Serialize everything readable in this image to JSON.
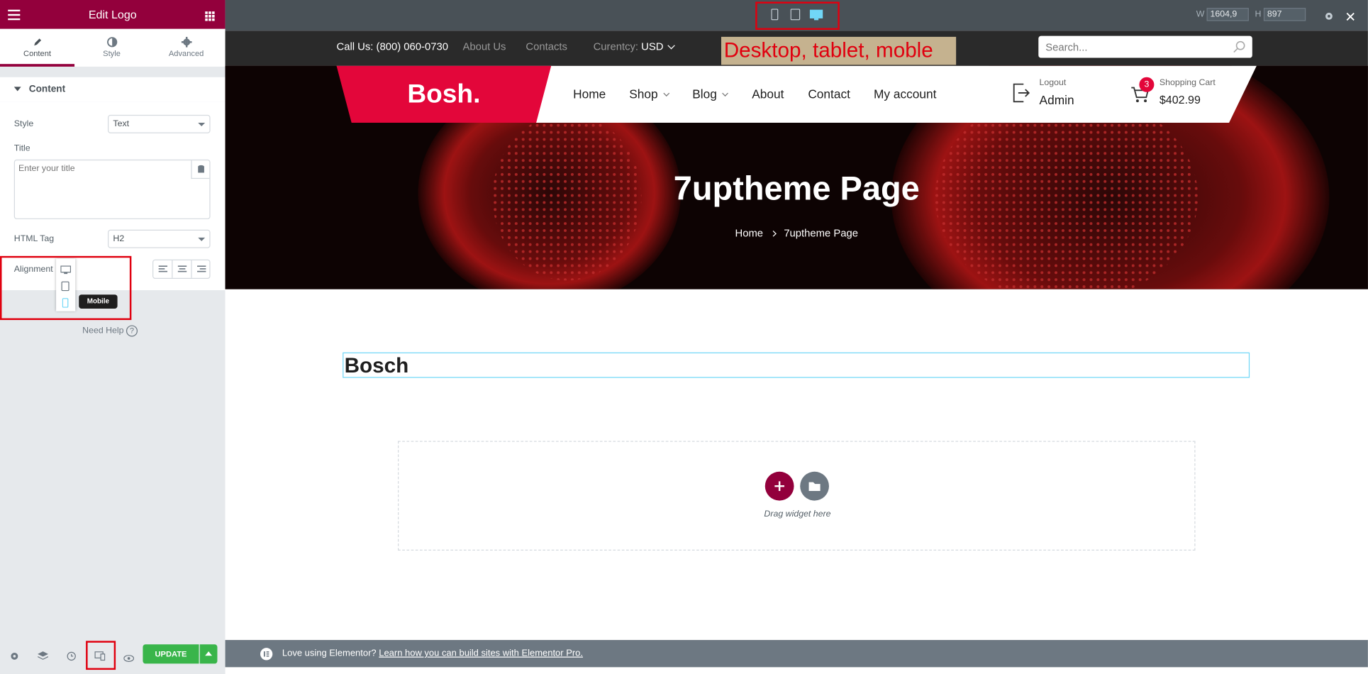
{
  "panel": {
    "title": "Edit Logo",
    "tabs": [
      {
        "label": "Content",
        "icon": "pencil-icon",
        "active": true
      },
      {
        "label": "Style",
        "icon": "contrast-icon"
      },
      {
        "label": "Advanced",
        "icon": "gear-icon"
      }
    ],
    "section_title": "Content",
    "style_label": "Style",
    "style_value": "Text",
    "title_label": "Title",
    "title_placeholder": "Enter your title",
    "html_tag_label": "HTML Tag",
    "html_tag_value": "H2",
    "alignment_label": "Alignment",
    "tooltip": "Mobile",
    "need_help": "Need Help",
    "update_label": "UPDATE"
  },
  "editor": {
    "width_label": "W",
    "width_value": "1604,9",
    "height_label": "H",
    "height_value": "897"
  },
  "annotation": "Desktop, tablet, moble",
  "site": {
    "call_us": "Call Us: (800) 060-0730",
    "about_us": "About Us",
    "contacts": "Contacts",
    "currency_label": "Curentcy:",
    "currency_value": "USD",
    "search_placeholder": "Search...",
    "logo": "Bosh.",
    "nav": [
      "Home",
      "Shop",
      "Blog",
      "About",
      "Contact",
      "My account"
    ],
    "logout_label": "Logout",
    "user": "Admin",
    "cart_count": "3",
    "cart_label": "Shopping Cart",
    "cart_total": "$402.99",
    "hero_title": "7uptheme Page",
    "breadcrumb_home": "Home",
    "breadcrumb_current": "7uptheme Page",
    "heading": "Bosch",
    "drag_text": "Drag widget here"
  },
  "notice": {
    "text": "Love using Elementor?",
    "link": "Learn how you can build sites with Elementor Pro."
  },
  "colors": {
    "brand": "#93003c",
    "update_green": "#39b54a",
    "logo_red": "#e3063a",
    "annotation_red": "#e0000f"
  }
}
